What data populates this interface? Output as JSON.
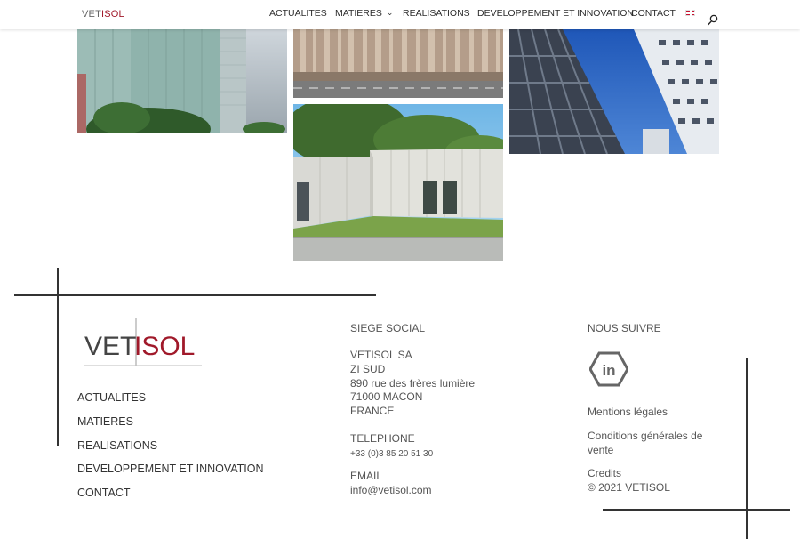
{
  "header": {
    "logo_part1": "VET",
    "logo_part2": "ISOL",
    "nav": [
      {
        "label": "ACTUALITES"
      },
      {
        "label": "MATIERES",
        "has_dropdown": true
      },
      {
        "label": "REALISATIONS"
      },
      {
        "label": "DEVELOPPEMENT ET INNOVATION"
      },
      {
        "label": "CONTACT"
      }
    ],
    "language_flag": "english-flag-icon",
    "search_icon": "search-icon"
  },
  "gallery": [
    {
      "name": "tall-green-facade-building"
    },
    {
      "name": "striped-facade-building"
    },
    {
      "name": "modern-grid-tower"
    },
    {
      "name": "white-panel-pavilion"
    }
  ],
  "footer": {
    "logo_part1": "VET",
    "logo_part2": "ISOL",
    "links": [
      "ACTUALITES",
      "MATIERES",
      "REALISATIONS",
      "DEVELOPPEMENT ET INNOVATION",
      "CONTACT"
    ],
    "siege": {
      "heading": "SIEGE SOCIAL",
      "company": "VETISOL SA",
      "line1": "ZI SUD",
      "line2": "890 rue des frères lumière",
      "line3": "71000 MACON",
      "line4": "FRANCE",
      "phone_label": "TELEPHONE",
      "phone": "+33 (0)3 85 20 51 30",
      "email_label": "EMAIL",
      "email": "info@vetisol.com"
    },
    "follow": {
      "heading": "NOUS SUIVRE",
      "icon": "linkedin-icon",
      "icon_text": "in",
      "mentions": "Mentions légales",
      "cgv": "Conditions générales de vente",
      "credits": "Credits",
      "copyright": "© 2021 VETISOL"
    }
  },
  "colors": {
    "brand_red": "#a0192a",
    "text": "#444444",
    "line": "#333333"
  }
}
